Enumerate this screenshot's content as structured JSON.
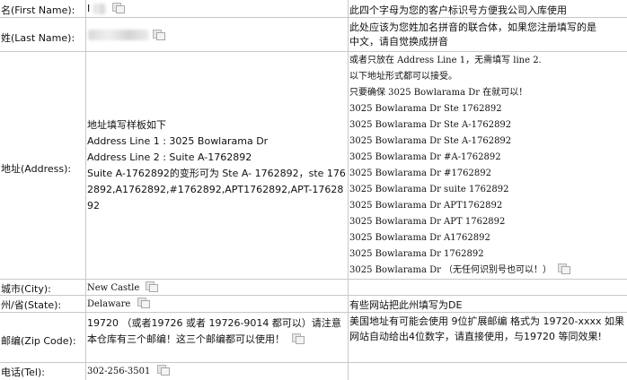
{
  "rows": {
    "first_name": {
      "label": "名(First Name):",
      "value": "I",
      "note": "此四个字母为您的客户标识号方便我公司入库使用"
    },
    "last_name": {
      "label": "姓(Last Name):",
      "note_line1": "此处应该为您姓加名拼音的联合体，如果您注册填写的是",
      "note_line2": "中文，请自觉换成拼音"
    },
    "address": {
      "label": "地址(Address):",
      "template_title": "地址填写样板如下",
      "line1": "Address Line 1 : 3025 Bowlarama Dr",
      "line2": "Address Line 2 :  Suite A-1762892",
      "variants": "Suite A-1762892的变形可为 Ste A- 1762892，ste 1762892,A1762892,#1762892,APT1762892,APT-1762892",
      "notes": [
        "或者只放在 Address Line 1，无需填写 line 2.",
        "以下地址形式都可以接受。",
        "只要确保 3025 Bowlarama Dr 在就可以！",
        "3025 Bowlarama Dr Ste 1762892",
        "3025 Bowlarama Dr Ste A-1762892",
        "3025 Bowlarama Dr Ste A-1762892",
        "3025 Bowlarama Dr #A-1762892",
        "3025 Bowlarama Dr #1762892",
        "3025 Bowlarama Dr suite 1762892",
        "3025 Bowlarama Dr APT1762892",
        "3025 Bowlarama Dr APT 1762892",
        "3025 Bowlarama Dr A1762892",
        "3025 Bowlarama Dr 1762892",
        "3025 Bowlarama Dr （无任何识别号也可以！）"
      ]
    },
    "city": {
      "label": "城市(City):",
      "value": "New Castle"
    },
    "state": {
      "label": "州/省(State):",
      "value": "Delaware",
      "note": "有些网站把此州填写为DE"
    },
    "zip": {
      "label": "邮编(Zip Code):",
      "value": "19720 （或者19726 或者 19726-9014 都可以）请注意本仓库有三个邮编！这三个邮编都可以使用！",
      "note": "美国地址有可能会使用 9位扩展邮编 格式为 19720-xxxx 如果网站自动给出4位数字，请直接使用，与19720 等同效果!"
    },
    "tel": {
      "label": "电话(Tel):",
      "value": "302-256-3501"
    }
  },
  "icons": {
    "copy": "copy-icon"
  }
}
